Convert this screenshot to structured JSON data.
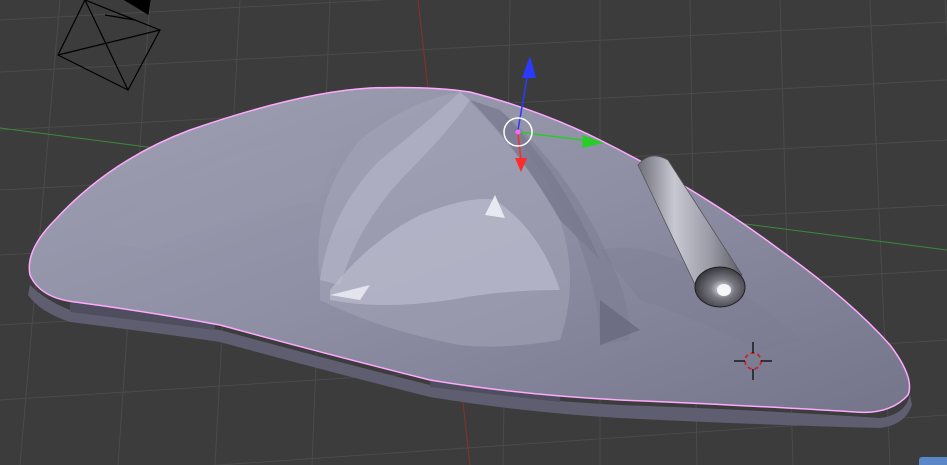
{
  "app": "3D viewport",
  "colors": {
    "background": "#3c3c3c",
    "grid_line": "#4a4a4a",
    "x_axis": "#3a8a3a",
    "y_axis": "#8a3030",
    "mesh_base": "#8e8ea4",
    "mesh_light": "#b2b2c6",
    "mesh_dark": "#6b6b7f",
    "selection_outline": "#ffaaff",
    "gizmo_z": "#2a3aff",
    "gizmo_y": "#2acc2a",
    "gizmo_x": "#ff2a2a",
    "cursor": "#cc2222"
  },
  "icons": [
    "camera-object-icon",
    "transform-gizmo-icon",
    "3d-cursor-icon",
    "lamp-cylinder-object"
  ]
}
